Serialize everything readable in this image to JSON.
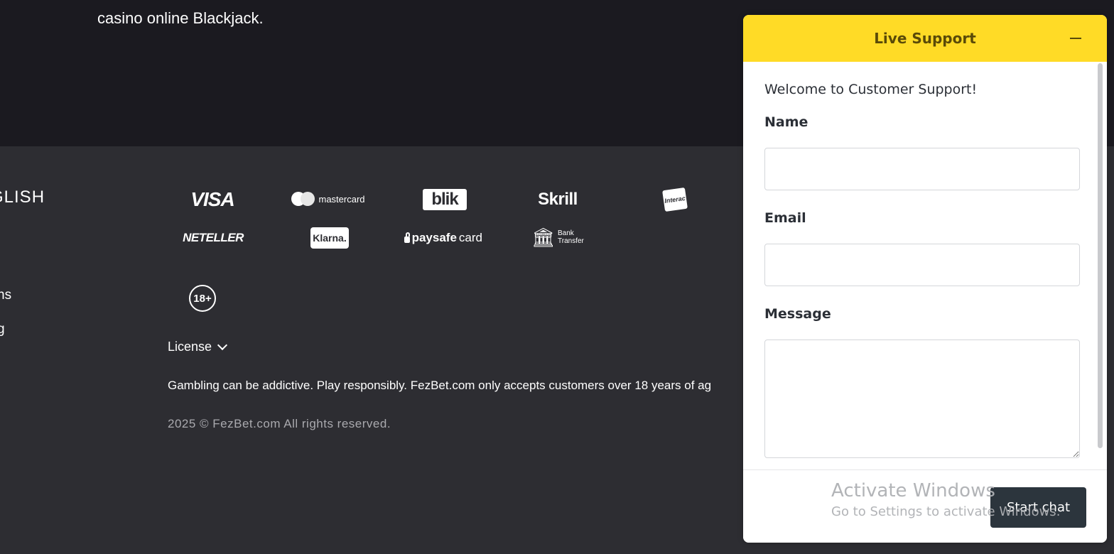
{
  "page": {
    "intro_text_fragment": "casino online Blackjack.",
    "language_fragment": "GLISH",
    "side_links": [
      "ns",
      "g"
    ]
  },
  "payments": {
    "visa": "VISA",
    "mastercard": "mastercard",
    "blik": "blik",
    "skrill": "Skrill",
    "interac": "Interac",
    "neteller": "NETELLER",
    "klarna": "Klarna.",
    "paysafecard_pay": "paysafe",
    "paysafecard_card": "card",
    "bank_line1": "Bank",
    "bank_line2": "Transfer"
  },
  "footer": {
    "age_badge": "18+",
    "license_label": "License",
    "disclaimer": "Gambling can be addictive. Play responsibly. FezBet.com only accepts customers over 18 years of ag",
    "copyright": "2025 © FezBet.com All rights reserved."
  },
  "chat": {
    "title": "Live Support",
    "welcome": "Welcome to Customer Support!",
    "name_label": "Name",
    "email_label": "Email",
    "message_label": "Message",
    "name_value": "",
    "email_value": "",
    "message_value": "",
    "start_button": "Start chat",
    "accent_color": "#ffdb26"
  },
  "os_watermark": {
    "line1": "Activate Windows",
    "line2": "Go to Settings to activate Windows."
  }
}
